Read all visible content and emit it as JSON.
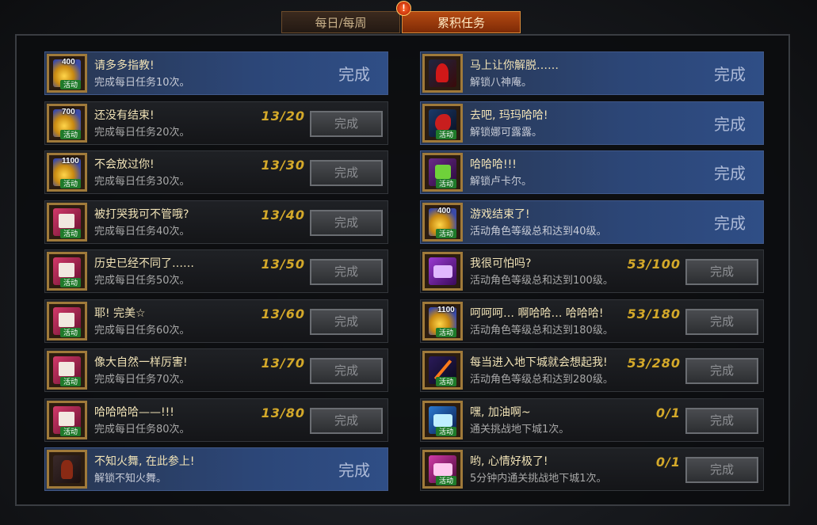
{
  "tabs": [
    {
      "label": "每日/每周"
    },
    {
      "label": "累积任务"
    }
  ],
  "alert_icon": "!",
  "left": [
    {
      "icon": "coin",
      "icon_num": "400",
      "badge": "活动",
      "title": "请多多指教!",
      "desc": "完成每日任务10次。",
      "progress": "",
      "done": true,
      "action": "完成"
    },
    {
      "icon": "coin",
      "icon_num": "700",
      "badge": "活动",
      "title": "还没有结束!",
      "desc": "完成每日任务20次。",
      "progress": "13/20",
      "done": false,
      "action": "完成"
    },
    {
      "icon": "coin",
      "icon_num": "1100",
      "badge": "活动",
      "title": "不会放过你!",
      "desc": "完成每日任务30次。",
      "progress": "13/30",
      "done": false,
      "action": "完成"
    },
    {
      "icon": "book",
      "icon_num": "",
      "badge": "活动",
      "title": "被打哭我可不管哦?",
      "desc": "完成每日任务40次。",
      "progress": "13/40",
      "done": false,
      "action": "完成"
    },
    {
      "icon": "book",
      "icon_num": "",
      "badge": "活动",
      "title": "历史已经不同了……",
      "desc": "完成每日任务50次。",
      "progress": "13/50",
      "done": false,
      "action": "完成"
    },
    {
      "icon": "book",
      "icon_num": "",
      "badge": "活动",
      "title": "耶! 完美☆",
      "desc": "完成每日任务60次。",
      "progress": "13/60",
      "done": false,
      "action": "完成"
    },
    {
      "icon": "book",
      "icon_num": "",
      "badge": "活动",
      "title": "像大自然一样厉害!",
      "desc": "完成每日任务70次。",
      "progress": "13/70",
      "done": false,
      "action": "完成"
    },
    {
      "icon": "book",
      "icon_num": "",
      "badge": "活动",
      "title": "哈哈哈哈——!!!",
      "desc": "完成每日任务80次。",
      "progress": "13/80",
      "done": false,
      "action": "完成"
    },
    {
      "icon": "dancer",
      "icon_num": "",
      "badge": "",
      "title": "不知火舞, 在此参上!",
      "desc": "解锁不知火舞。",
      "progress": "",
      "done": true,
      "action": "完成"
    }
  ],
  "right": [
    {
      "icon": "demon",
      "icon_num": "",
      "badge": "",
      "title": "马上让你解脱……",
      "desc": "解锁八神庵。",
      "progress": "",
      "done": true,
      "action": "完成"
    },
    {
      "icon": "rooster",
      "icon_num": "",
      "badge": "活动",
      "title": "去吧, 玛玛哈哈!",
      "desc": "解锁娜可露露。",
      "progress": "",
      "done": true,
      "action": "完成"
    },
    {
      "icon": "gift",
      "icon_num": "",
      "badge": "活动",
      "title": "哈哈哈!!!",
      "desc": "解锁卢卡尔。",
      "progress": "",
      "done": true,
      "action": "完成"
    },
    {
      "icon": "coin",
      "icon_num": "400",
      "badge": "活动",
      "title": "游戏结束了!",
      "desc": "活动角色等级总和达到40级。",
      "progress": "",
      "done": true,
      "action": "完成"
    },
    {
      "icon": "chest",
      "icon_num": "",
      "badge": "",
      "title": "我很可怕吗?",
      "desc": "活动角色等级总和达到100级。",
      "progress": "53/100",
      "done": false,
      "action": "完成"
    },
    {
      "icon": "coin",
      "icon_num": "1100",
      "badge": "活动",
      "title": "呵呵呵… 啊哈哈… 哈哈哈!",
      "desc": "活动角色等级总和达到180级。",
      "progress": "53/180",
      "done": false,
      "action": "完成"
    },
    {
      "icon": "sword",
      "icon_num": "",
      "badge": "活动",
      "title": "每当进入地下城就会想起我!",
      "desc": "活动角色等级总和达到280级。",
      "progress": "53/280",
      "done": false,
      "action": "完成"
    },
    {
      "icon": "chest2",
      "icon_num": "",
      "badge": "活动",
      "title": "嘿, 加油啊~",
      "desc": "通关挑战地下城1次。",
      "progress": "0/1",
      "done": false,
      "action": "完成"
    },
    {
      "icon": "chest3",
      "icon_num": "",
      "badge": "活动",
      "title": "哟, 心情好极了!",
      "desc": "5分钟内通关挑战地下城1次。",
      "progress": "0/1",
      "done": false,
      "action": "完成"
    }
  ]
}
